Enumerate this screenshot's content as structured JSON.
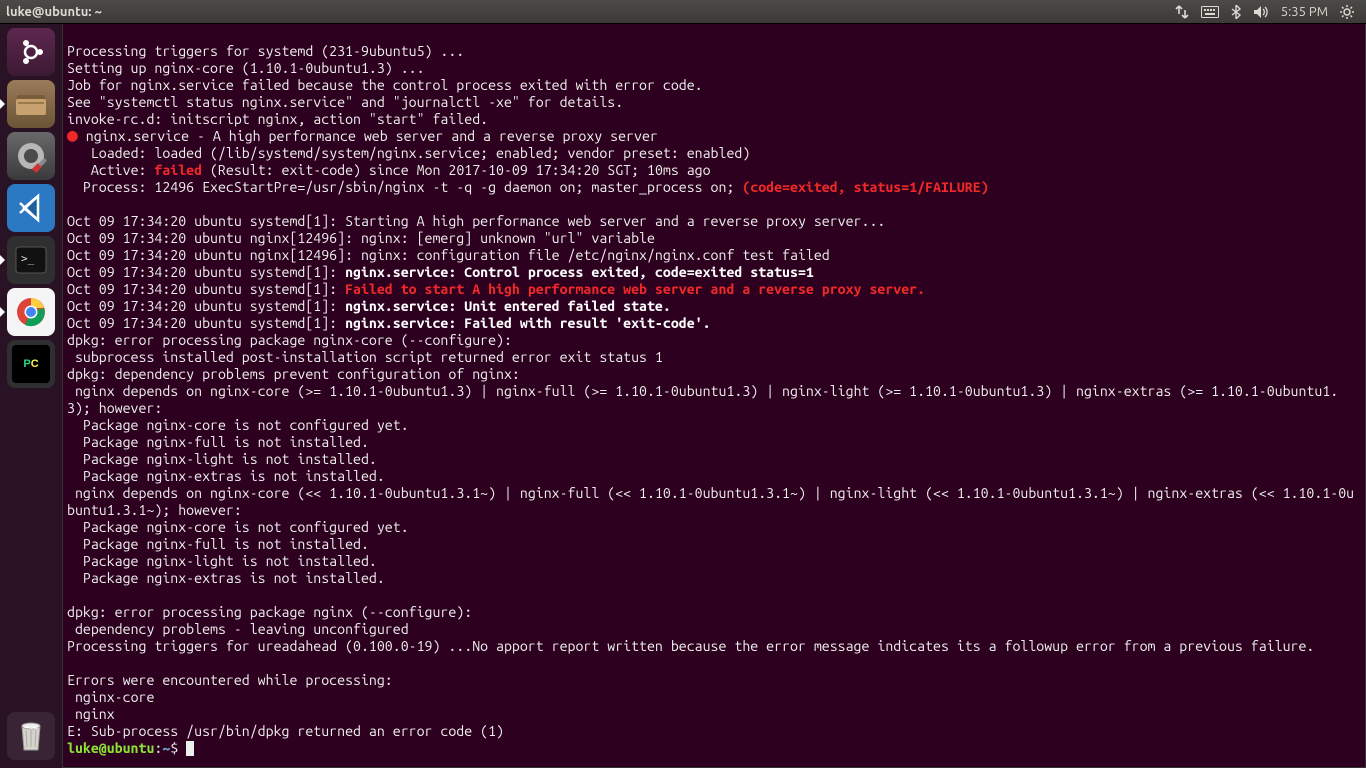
{
  "menubar": {
    "title": "luke@ubuntu: ~",
    "time": "5:35 PM"
  },
  "launcher": {
    "items": [
      {
        "id": "dash",
        "name": "ubuntu-dash",
        "pip": false
      },
      {
        "id": "files",
        "name": "files",
        "pip": true
      },
      {
        "id": "settings",
        "name": "settings",
        "pip": false
      },
      {
        "id": "vscode",
        "name": "vscode",
        "pip": false
      },
      {
        "id": "terminal",
        "name": "terminal",
        "pip": true
      },
      {
        "id": "chrome",
        "name": "chrome",
        "pip": true
      },
      {
        "id": "pycharm",
        "name": "pycharm",
        "pip": false
      }
    ],
    "trash": {
      "name": "trash"
    }
  },
  "terminal": {
    "l01": "Processing triggers for systemd (231-9ubuntu5) ...",
    "l02": "Setting up nginx-core (1.10.1-0ubuntu1.3) ...",
    "l03": "Job for nginx.service failed because the control process exited with error code.",
    "l04": "See \"systemctl status nginx.service\" and \"journalctl -xe\" for details.",
    "l05": "invoke-rc.d: initscript nginx, action \"start\" failed.",
    "l06a": " nginx.service - A high performance web server and a reverse proxy server",
    "l07": "   Loaded: loaded (/lib/systemd/system/nginx.service; enabled; vendor preset: enabled)",
    "l08a": "   Active: ",
    "l08b": "failed",
    "l08c": " (Result: exit-code) since Mon 2017-10-09 17:34:20 SGT; 10ms ago",
    "l09a": "  Process: 12496 ExecStartPre=/usr/sbin/nginx -t -q -g daemon on; master_process on; ",
    "l09b": "(code=exited, status=1/FAILURE)",
    "l10": "",
    "l11": "Oct 09 17:34:20 ubuntu systemd[1]: Starting A high performance web server and a reverse proxy server...",
    "l12": "Oct 09 17:34:20 ubuntu nginx[12496]: nginx: [emerg] unknown \"url\" variable",
    "l13": "Oct 09 17:34:20 ubuntu nginx[12496]: nginx: configuration file /etc/nginx/nginx.conf test failed",
    "l14a": "Oct 09 17:34:20 ubuntu systemd[1]: ",
    "l14b": "nginx.service: Control process exited, code=exited status=1",
    "l15a": "Oct 09 17:34:20 ubuntu systemd[1]: ",
    "l15b": "Failed to start A high performance web server and a reverse proxy server.",
    "l16a": "Oct 09 17:34:20 ubuntu systemd[1]: ",
    "l16b": "nginx.service: Unit entered failed state.",
    "l17a": "Oct 09 17:34:20 ubuntu systemd[1]: ",
    "l17b": "nginx.service: Failed with result 'exit-code'.",
    "l18": "dpkg: error processing package nginx-core (--configure):",
    "l19": " subprocess installed post-installation script returned error exit status 1",
    "l20": "dpkg: dependency problems prevent configuration of nginx:",
    "l21": " nginx depends on nginx-core (>= 1.10.1-0ubuntu1.3) | nginx-full (>= 1.10.1-0ubuntu1.3) | nginx-light (>= 1.10.1-0ubuntu1.3) | nginx-extras (>= 1.10.1-0ubuntu1.3); however:",
    "l22": "  Package nginx-core is not configured yet.",
    "l23": "  Package nginx-full is not installed.",
    "l24": "  Package nginx-light is not installed.",
    "l25": "  Package nginx-extras is not installed.",
    "l26": " nginx depends on nginx-core (<< 1.10.1-0ubuntu1.3.1~) | nginx-full (<< 1.10.1-0ubuntu1.3.1~) | nginx-light (<< 1.10.1-0ubuntu1.3.1~) | nginx-extras (<< 1.10.1-0ubuntu1.3.1~); however:",
    "l27": "  Package nginx-core is not configured yet.",
    "l28": "  Package nginx-full is not installed.",
    "l29": "  Package nginx-light is not installed.",
    "l30": "  Package nginx-extras is not installed.",
    "l31": "",
    "l32": "dpkg: error processing package nginx (--configure):",
    "l33": " dependency problems - leaving unconfigured",
    "l34": "Processing triggers for ureadahead (0.100.0-19) ...No apport report written because the error message indicates its a followup error from a previous failure.",
    "l35": "",
    "l36": "Errors were encountered while processing:",
    "l37": " nginx-core",
    "l38": " nginx",
    "l39": "E: Sub-process /usr/bin/dpkg returned an error code (1)",
    "prompt_user": "luke@ubuntu",
    "prompt_sep1": ":",
    "prompt_path": "~",
    "prompt_sep2": "$ "
  }
}
